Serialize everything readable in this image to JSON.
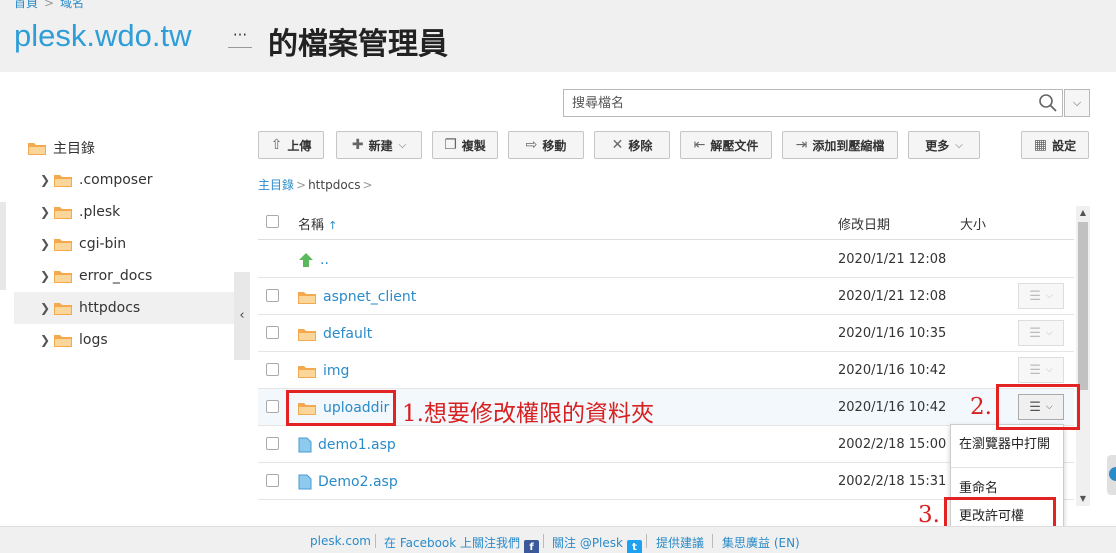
{
  "header": {
    "breadcrumb": [
      "首頁",
      "域名"
    ],
    "site": "plesk.wdo.tw",
    "more_label": "···",
    "page_title": "的檔案管理員"
  },
  "search": {
    "placeholder": "搜尋檔名"
  },
  "tree": {
    "root": "主目錄",
    "items": [
      ".composer",
      ".plesk",
      "cgi-bin",
      "error_docs",
      "httpdocs",
      "logs"
    ],
    "active": "httpdocs"
  },
  "toolbar": {
    "upload": "上傳",
    "new": "新建",
    "copy": "複製",
    "move": "移動",
    "delete": "移除",
    "extract": "解壓文件",
    "archive": "添加到壓縮檔",
    "more": "更多",
    "settings": "設定"
  },
  "breadcrumb": {
    "root": "主目錄",
    "current": "httpdocs"
  },
  "table": {
    "columns": {
      "name": "名稱",
      "date": "修改日期",
      "size": "大小"
    },
    "rows": [
      {
        "name": "..",
        "date": "2020/1/21 12:08",
        "type": "up"
      },
      {
        "name": "aspnet_client",
        "date": "2020/1/21 12:08",
        "type": "folder"
      },
      {
        "name": "default",
        "date": "2020/1/16 10:35",
        "type": "folder"
      },
      {
        "name": "img",
        "date": "2020/1/16 10:42",
        "type": "folder"
      },
      {
        "name": "uploaddir",
        "date": "2020/1/16 10:42",
        "type": "folder"
      },
      {
        "name": "demo1.asp",
        "date": "2002/2/18 15:00",
        "type": "file"
      },
      {
        "name": "Demo2.asp",
        "date": "2002/2/18 15:31",
        "type": "file"
      }
    ]
  },
  "context_menu": {
    "open_in_browser": "在瀏覽器中打開",
    "rename": "重命名",
    "change_permissions": "更改許可權"
  },
  "annotations": {
    "note1": "1.想要修改權限的資料夾",
    "note2": "2.",
    "note3": "3."
  },
  "footer": {
    "site": "plesk.com",
    "facebook": "在 Facebook 上關注我們",
    "twitter": "關注 @Plesk",
    "suggest": "提供建議",
    "uservoice": "集思廣益 (EN)"
  },
  "colors": {
    "accent": "#2f9ed8",
    "link": "#2a8bc9",
    "folder": "#f5a94e",
    "annotation": "#e32323"
  }
}
